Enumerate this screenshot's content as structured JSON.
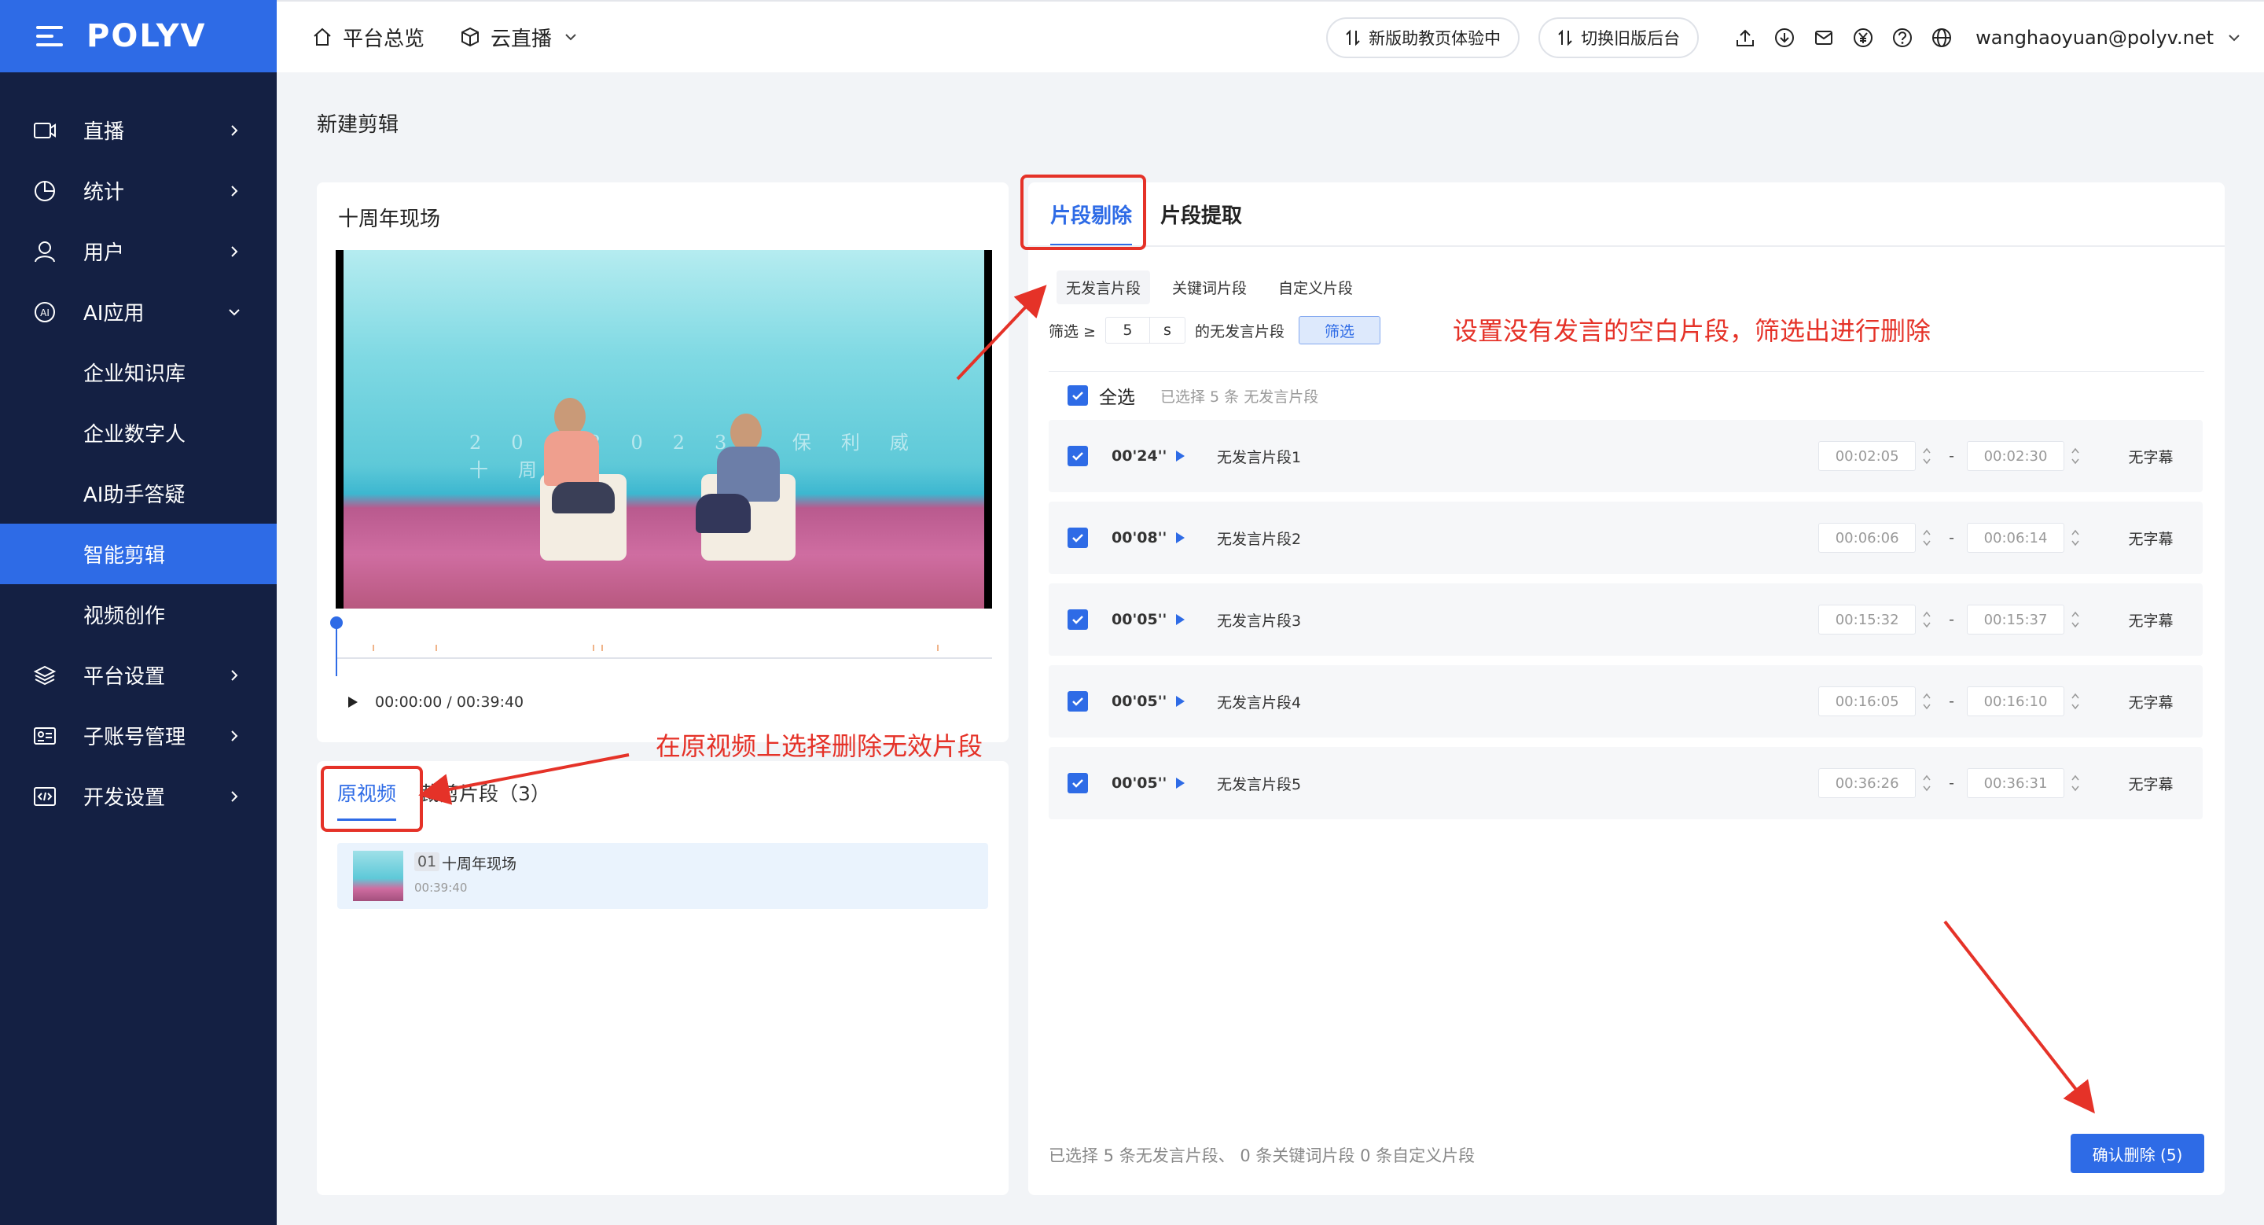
{
  "brand": {
    "logo": "POLYV",
    "accent": "#2e6be6",
    "sidebar_bg": "#142043"
  },
  "sidebar": {
    "items": [
      {
        "label": "直播",
        "icon": "live-camera-icon"
      },
      {
        "label": "统计",
        "icon": "pie-chart-icon"
      },
      {
        "label": "用户",
        "icon": "user-icon"
      },
      {
        "label": "AI应用",
        "icon": "ai-icon"
      },
      {
        "label": "企业知识库"
      },
      {
        "label": "企业数字人"
      },
      {
        "label": "AI助手答疑"
      },
      {
        "label": "智能剪辑"
      },
      {
        "label": "视频创作"
      },
      {
        "label": "平台设置",
        "icon": "layers-icon"
      },
      {
        "label": "子账号管理",
        "icon": "id-card-icon"
      },
      {
        "label": "开发设置",
        "icon": "code-icon"
      }
    ]
  },
  "header": {
    "overview": "平台总览",
    "cloud_live": "云直播",
    "new_assistant": "新版助教页体验中",
    "switch_old": "切换旧版后台",
    "email": "wanghaoyuan@polyv.net"
  },
  "page": {
    "title": "新建剪辑"
  },
  "video": {
    "title": "十周年现场",
    "stage_text": "20  2023  保利威十周",
    "time": "00:00:00 / 00:39:40"
  },
  "clips": {
    "tabs": [
      "原视频",
      "裁剪片段（3）"
    ],
    "item": {
      "no": "01",
      "name": "十周年现场",
      "duration": "00:39:40"
    }
  },
  "edit": {
    "tabs": [
      "片段剔除",
      "片段提取"
    ],
    "subtabs": [
      "无发言片段",
      "关键词片段",
      "自定义片段"
    ],
    "filter": {
      "prefix": "筛选 ≥",
      "value": "5",
      "unit": "s",
      "suffix": "的无发言片段",
      "button": "筛选"
    },
    "select_all": "全选",
    "selected_hint": "已选择 5 条 无发言片段",
    "segments": [
      {
        "duration": "00'24''",
        "name": "无发言片段1",
        "start": "00:02:05",
        "end": "00:02:30",
        "subtitle": "无字幕"
      },
      {
        "duration": "00'08''",
        "name": "无发言片段2",
        "start": "00:06:06",
        "end": "00:06:14",
        "subtitle": "无字幕"
      },
      {
        "duration": "00'05''",
        "name": "无发言片段3",
        "start": "00:15:32",
        "end": "00:15:37",
        "subtitle": "无字幕"
      },
      {
        "duration": "00'05''",
        "name": "无发言片段4",
        "start": "00:16:05",
        "end": "00:16:10",
        "subtitle": "无字幕"
      },
      {
        "duration": "00'05''",
        "name": "无发言片段5",
        "start": "00:36:26",
        "end": "00:36:31",
        "subtitle": "无字幕"
      }
    ],
    "footer": "已选择 5 条无发言片段、 0 条关键词片段 0 条自定义片段",
    "confirm": "确认删除 (5)"
  },
  "annotations": {
    "note_top": "设置没有发言的空白片段，筛选出进行删除",
    "note_bottom": "在原视频上选择删除无效片段",
    "color": "#e53228"
  }
}
